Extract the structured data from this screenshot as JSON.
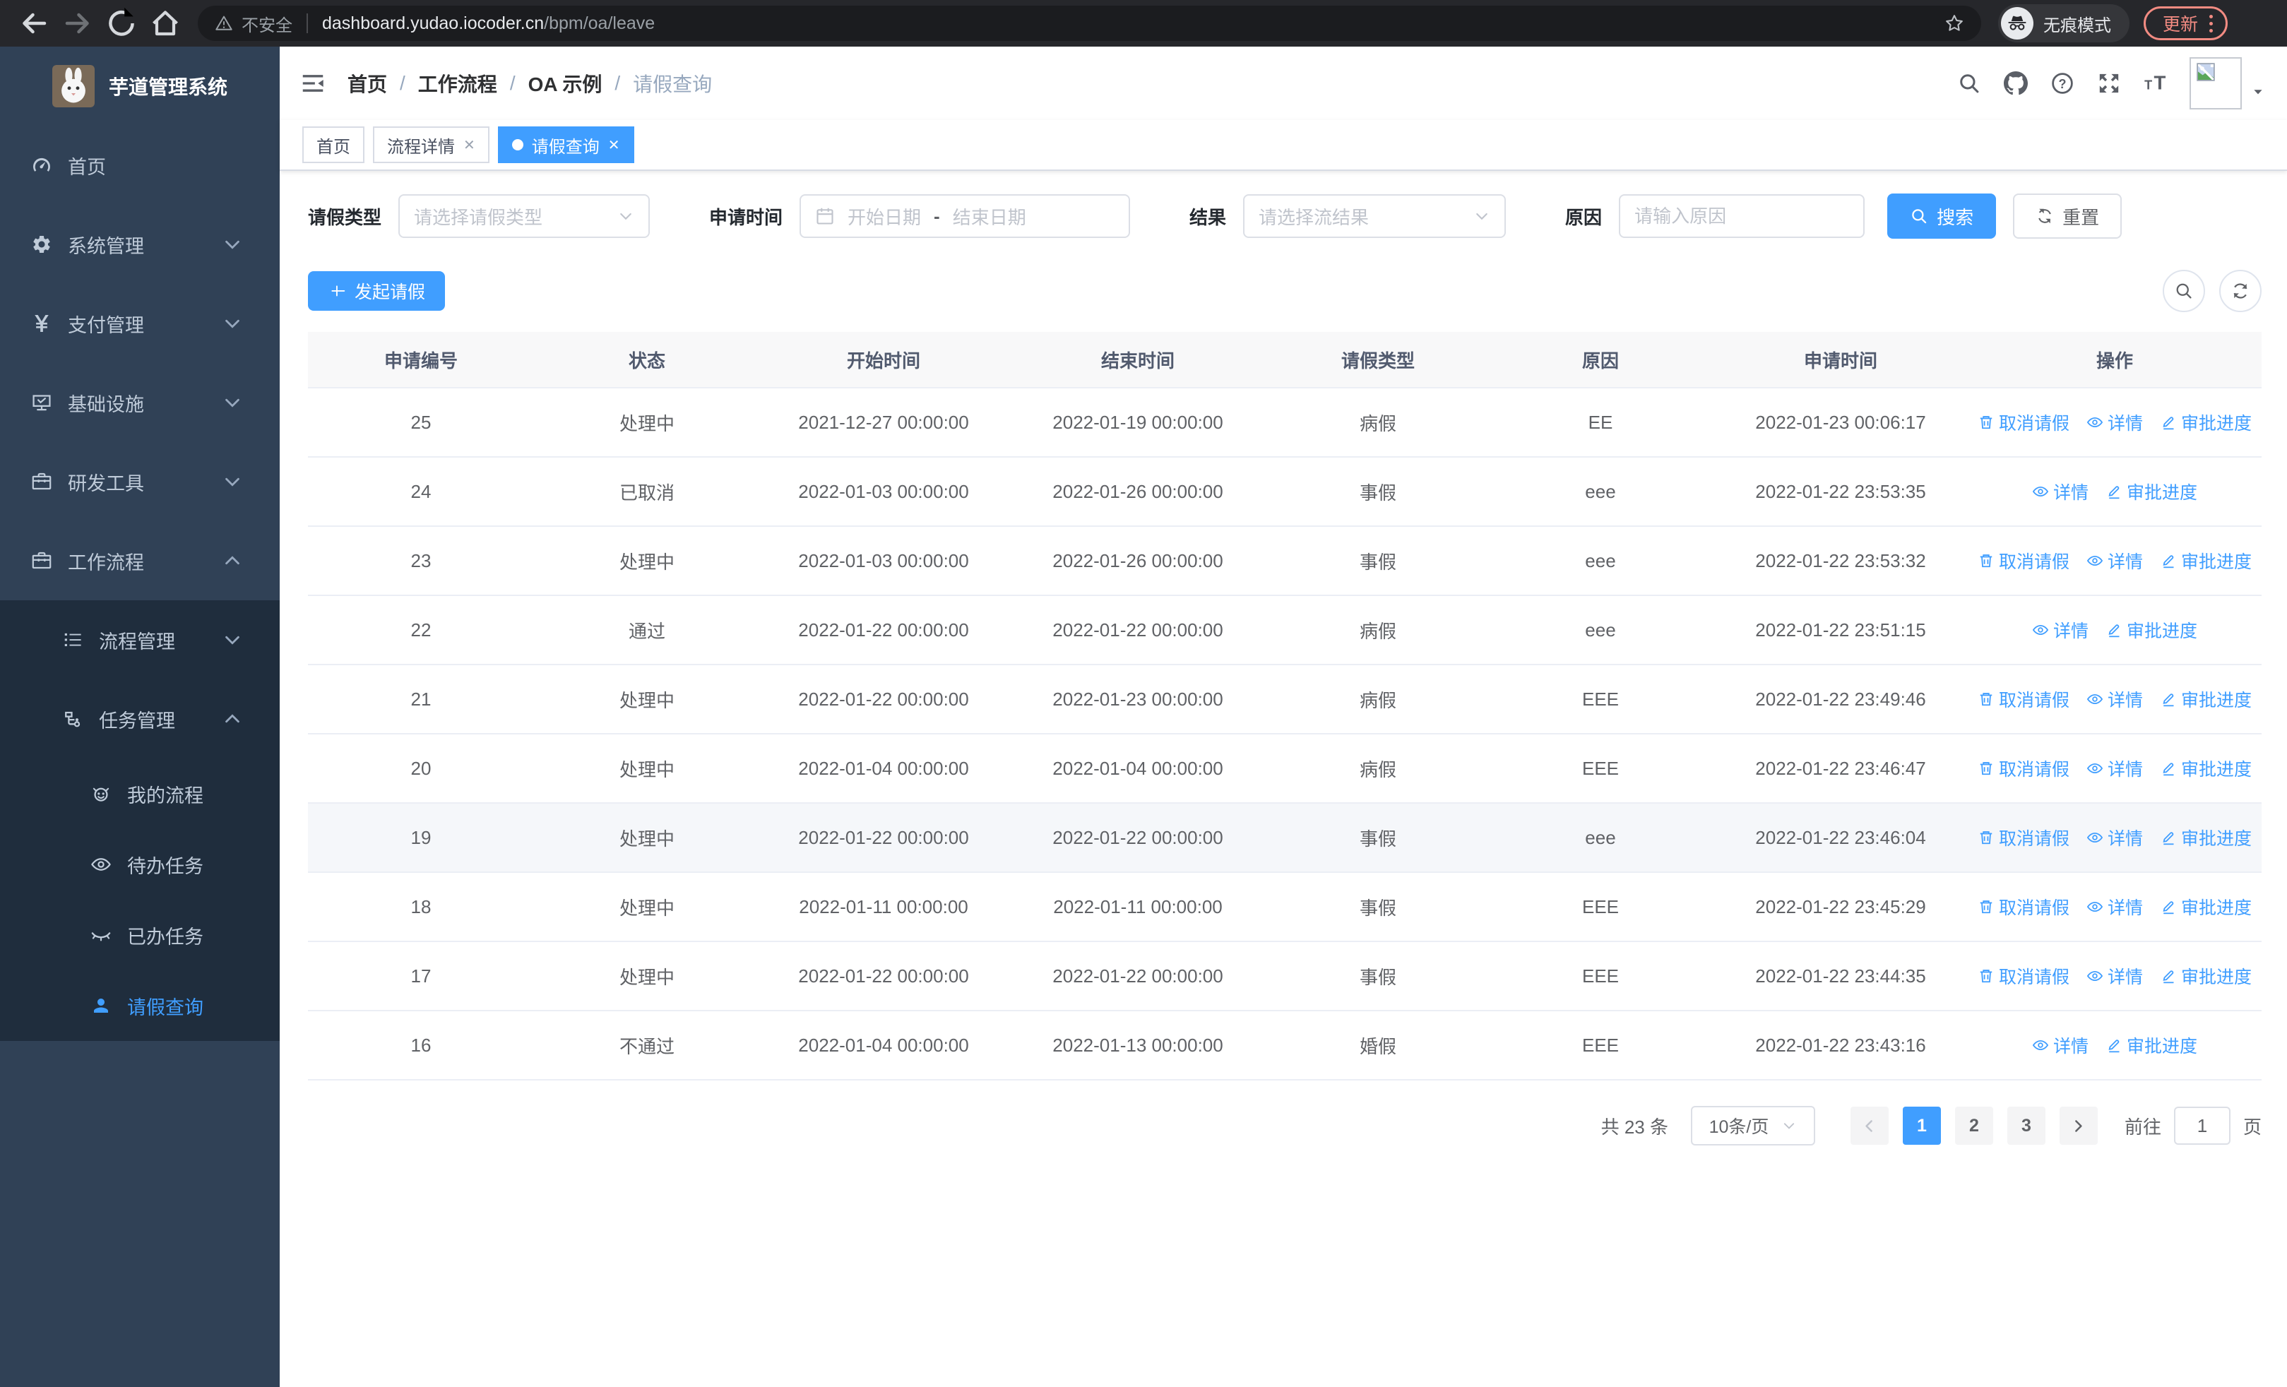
{
  "colors": {
    "primary": "#409eff",
    "sidebar_bg": "#304156",
    "submenu_bg": "#1f2d3d",
    "update_accent": "#f28b82"
  },
  "browser": {
    "security_label": "不安全",
    "url_host": "dashboard.yudao.iocoder.cn",
    "url_path": "/bpm/oa/leave",
    "incognito_label": "无痕模式",
    "update_label": "更新"
  },
  "sidebar": {
    "title": "芋道管理系统",
    "items": [
      {
        "label": "首页",
        "icon": "dashboard",
        "level": 1
      },
      {
        "label": "系统管理",
        "icon": "gear",
        "level": 1,
        "chevron": "down"
      },
      {
        "label": "支付管理",
        "icon": "yen",
        "level": 1,
        "chevron": "down"
      },
      {
        "label": "基础设施",
        "icon": "monitor",
        "level": 1,
        "chevron": "down"
      },
      {
        "label": "研发工具",
        "icon": "toolbox",
        "level": 1,
        "chevron": "down"
      },
      {
        "label": "工作流程",
        "icon": "toolbox",
        "level": 1,
        "chevron": "up"
      },
      {
        "label": "流程管理",
        "icon": "list",
        "level": 2,
        "chevron": "down",
        "submenu": true
      },
      {
        "label": "任务管理",
        "icon": "tree",
        "level": 2,
        "chevron": "up",
        "submenu": true
      },
      {
        "label": "我的流程",
        "icon": "face",
        "level": 3,
        "submenu": true
      },
      {
        "label": "待办任务",
        "icon": "eye",
        "level": 3,
        "submenu": true
      },
      {
        "label": "已办任务",
        "icon": "eye-off",
        "level": 3,
        "submenu": true
      },
      {
        "label": "请假查询",
        "icon": "user",
        "level": 3,
        "submenu": true,
        "active": true
      }
    ]
  },
  "navbar": {
    "breadcrumb": [
      "首页",
      "工作流程",
      "OA 示例",
      "请假查询"
    ],
    "icons": [
      "search",
      "github",
      "help",
      "fullscreen",
      "fontsize"
    ]
  },
  "tabs": [
    {
      "label": "首页"
    },
    {
      "label": "流程详情",
      "closable": true
    },
    {
      "label": "请假查询",
      "closable": true,
      "active": true
    }
  ],
  "filters": {
    "leave_type_label": "请假类型",
    "leave_type_placeholder": "请选择请假类型",
    "apply_time_label": "申请时间",
    "date_start_placeholder": "开始日期",
    "date_separator": "-",
    "date_end_placeholder": "结束日期",
    "result_label": "结果",
    "result_placeholder": "请选择流结果",
    "reason_label": "原因",
    "reason_placeholder": "请输入原因",
    "search_label": "搜索",
    "reset_label": "重置"
  },
  "toolbar": {
    "create_label": "发起请假"
  },
  "table": {
    "columns": [
      "申请编号",
      "状态",
      "开始时间",
      "结束时间",
      "请假类型",
      "原因",
      "申请时间",
      "操作"
    ],
    "action_labels": {
      "cancel": "取消请假",
      "detail": "详情",
      "progress": "审批进度"
    },
    "rows": [
      {
        "id": "25",
        "status": "处理中",
        "start": "2021-12-27 00:00:00",
        "end": "2022-01-19 00:00:00",
        "type": "病假",
        "reason": "EE",
        "apply_time": "2022-01-23 00:06:17",
        "actions": [
          "cancel",
          "detail",
          "progress"
        ]
      },
      {
        "id": "24",
        "status": "已取消",
        "start": "2022-01-03 00:00:00",
        "end": "2022-01-26 00:00:00",
        "type": "事假",
        "reason": "eee",
        "apply_time": "2022-01-22 23:53:35",
        "actions": [
          "detail",
          "progress"
        ]
      },
      {
        "id": "23",
        "status": "处理中",
        "start": "2022-01-03 00:00:00",
        "end": "2022-01-26 00:00:00",
        "type": "事假",
        "reason": "eee",
        "apply_time": "2022-01-22 23:53:32",
        "actions": [
          "cancel",
          "detail",
          "progress"
        ]
      },
      {
        "id": "22",
        "status": "通过",
        "start": "2022-01-22 00:00:00",
        "end": "2022-01-22 00:00:00",
        "type": "病假",
        "reason": "eee",
        "apply_time": "2022-01-22 23:51:15",
        "actions": [
          "detail",
          "progress"
        ]
      },
      {
        "id": "21",
        "status": "处理中",
        "start": "2022-01-22 00:00:00",
        "end": "2022-01-23 00:00:00",
        "type": "病假",
        "reason": "EEE",
        "apply_time": "2022-01-22 23:49:46",
        "actions": [
          "cancel",
          "detail",
          "progress"
        ]
      },
      {
        "id": "20",
        "status": "处理中",
        "start": "2022-01-04 00:00:00",
        "end": "2022-01-04 00:00:00",
        "type": "病假",
        "reason": "EEE",
        "apply_time": "2022-01-22 23:46:47",
        "actions": [
          "cancel",
          "detail",
          "progress"
        ]
      },
      {
        "id": "19",
        "status": "处理中",
        "start": "2022-01-22 00:00:00",
        "end": "2022-01-22 00:00:00",
        "type": "事假",
        "reason": "eee",
        "apply_time": "2022-01-22 23:46:04",
        "actions": [
          "cancel",
          "detail",
          "progress"
        ],
        "highlighted": true
      },
      {
        "id": "18",
        "status": "处理中",
        "start": "2022-01-11 00:00:00",
        "end": "2022-01-11 00:00:00",
        "type": "事假",
        "reason": "EEE",
        "apply_time": "2022-01-22 23:45:29",
        "actions": [
          "cancel",
          "detail",
          "progress"
        ]
      },
      {
        "id": "17",
        "status": "处理中",
        "start": "2022-01-22 00:00:00",
        "end": "2022-01-22 00:00:00",
        "type": "事假",
        "reason": "EEE",
        "apply_time": "2022-01-22 23:44:35",
        "actions": [
          "cancel",
          "detail",
          "progress"
        ]
      },
      {
        "id": "16",
        "status": "不通过",
        "start": "2022-01-04 00:00:00",
        "end": "2022-01-13 00:00:00",
        "type": "婚假",
        "reason": "EEE",
        "apply_time": "2022-01-22 23:43:16",
        "actions": [
          "detail",
          "progress"
        ]
      }
    ]
  },
  "pagination": {
    "total_label": "共 23 条",
    "page_size_label": "10条/页",
    "pages": [
      "1",
      "2",
      "3"
    ],
    "active_page": "1",
    "goto_label": "前往",
    "goto_value": "1",
    "goto_unit_label": "页"
  }
}
